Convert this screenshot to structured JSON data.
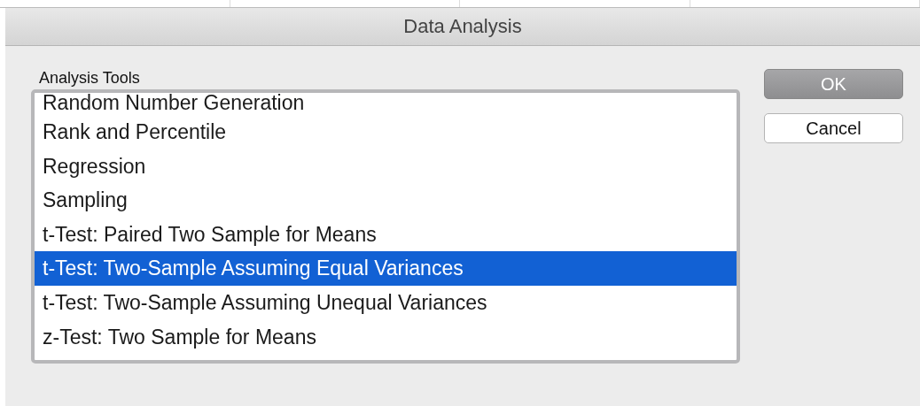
{
  "window": {
    "title": "Data Analysis"
  },
  "analysis_tools": {
    "label": "Analysis Tools",
    "items": [
      {
        "label": "Random Number Generation",
        "selected": false
      },
      {
        "label": "Rank and Percentile",
        "selected": false
      },
      {
        "label": "Regression",
        "selected": false
      },
      {
        "label": "Sampling",
        "selected": false
      },
      {
        "label": "t-Test: Paired Two Sample for Means",
        "selected": false
      },
      {
        "label": "t-Test: Two-Sample Assuming Equal Variances",
        "selected": true
      },
      {
        "label": "t-Test: Two-Sample Assuming Unequal Variances",
        "selected": false
      },
      {
        "label": "z-Test: Two Sample for Means",
        "selected": false
      }
    ]
  },
  "buttons": [
    {
      "label": "OK",
      "kind": "default"
    },
    {
      "label": "Cancel",
      "kind": "normal"
    }
  ]
}
